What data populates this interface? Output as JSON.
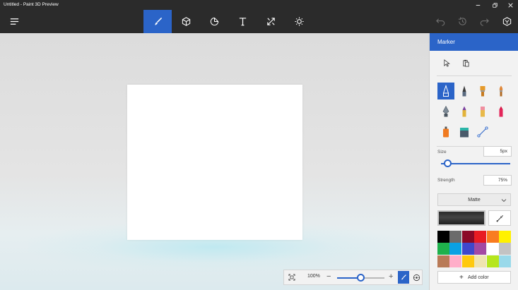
{
  "window": {
    "title": "Untitled - Paint 3D Preview",
    "controls": [
      "minimize-icon",
      "maximize-icon",
      "close-icon"
    ]
  },
  "toolbar": {
    "menu_icon": "hamburger-menu-icon",
    "tools": [
      {
        "name": "brushes",
        "icon": "brush-icon",
        "active": true
      },
      {
        "name": "3d-objects",
        "icon": "cube-icon",
        "active": false
      },
      {
        "name": "stickers",
        "icon": "sticker-icon",
        "active": false
      },
      {
        "name": "text",
        "icon": "text-icon",
        "active": false
      },
      {
        "name": "canvas",
        "icon": "canvas-resize-icon",
        "active": false
      },
      {
        "name": "effects",
        "icon": "sun-icon",
        "active": false
      }
    ],
    "right_icons": [
      "undo-icon",
      "history-icon",
      "redo-icon",
      "remix3d-icon"
    ]
  },
  "zoom": {
    "percent": "100%",
    "level": 0.5
  },
  "panel": {
    "title": "Marker",
    "brush_tools": [
      "marker",
      "calligraphy-pen",
      "oil-brush",
      "watercolor",
      "pixel-pen",
      "pencil",
      "eraser",
      "crayon",
      "spray-can",
      "fill-bucket",
      "line-tool"
    ],
    "selected_brush": "marker",
    "size": {
      "label": "Size",
      "value": "5px",
      "level": 0.1
    },
    "strength": {
      "label": "Strength",
      "value": "75%"
    },
    "finish": {
      "value": "Matte"
    },
    "current_color": "#2a2a2a",
    "palette": [
      "#000000",
      "#6b6b6b",
      "#8b0a27",
      "#e81c23",
      "#f97c20",
      "#fff100",
      "#1fb14c",
      "#0aa1e3",
      "#3f48cc",
      "#a349a3",
      "#ffffff",
      "#c3c3c3",
      "#b97a57",
      "#ffaec9",
      "#ffc90e",
      "#efe4b0",
      "#b5e61d",
      "#99d9ea"
    ],
    "add_color_label": "Add color"
  },
  "colors": {
    "accent": "#2b64c8",
    "chrome": "#2b2b2b",
    "panel_bg": "#f2f2f2"
  }
}
